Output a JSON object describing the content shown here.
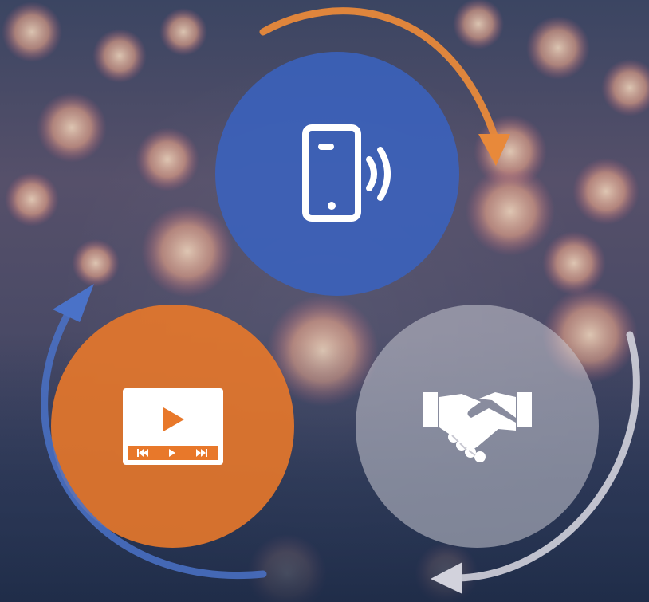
{
  "diagram": {
    "nodes": [
      {
        "id": "phone",
        "icon": "smartphone-wireless-icon",
        "color": "#3a62be"
      },
      {
        "id": "video",
        "icon": "video-player-icon",
        "color": "#e8782a"
      },
      {
        "id": "handshake",
        "icon": "handshake-icon",
        "color": "#c8c8d2"
      }
    ],
    "cycle_arrows": [
      {
        "from": "phone",
        "to": "handshake",
        "color": "#e8893a"
      },
      {
        "from": "handshake",
        "to": "video",
        "color": "#c8c8d2"
      },
      {
        "from": "video",
        "to": "phone",
        "color": "#4a72c8"
      }
    ]
  },
  "background": {
    "theme": "floating lotus lanterns on water"
  }
}
